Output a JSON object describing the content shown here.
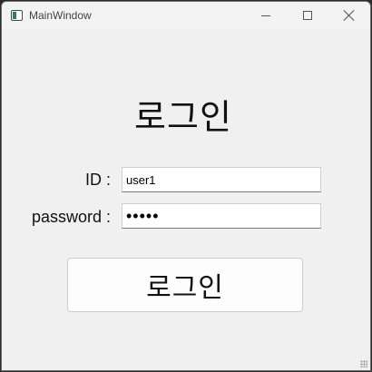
{
  "window": {
    "title": "MainWindow",
    "icon": "window-app-icon",
    "controls": [
      "minimize-icon",
      "maximize-icon",
      "close-icon"
    ]
  },
  "login": {
    "heading": "로그인",
    "id_label": "ID :",
    "id_value": "user1",
    "password_label": "password :",
    "password_value": "•••••",
    "button_label": "로그인"
  },
  "colors": {
    "window_bg": "#f0f0f0",
    "titlebar_bg": "#f3f3f3",
    "field_bg": "#ffffff",
    "button_bg": "#fdfdfd"
  }
}
